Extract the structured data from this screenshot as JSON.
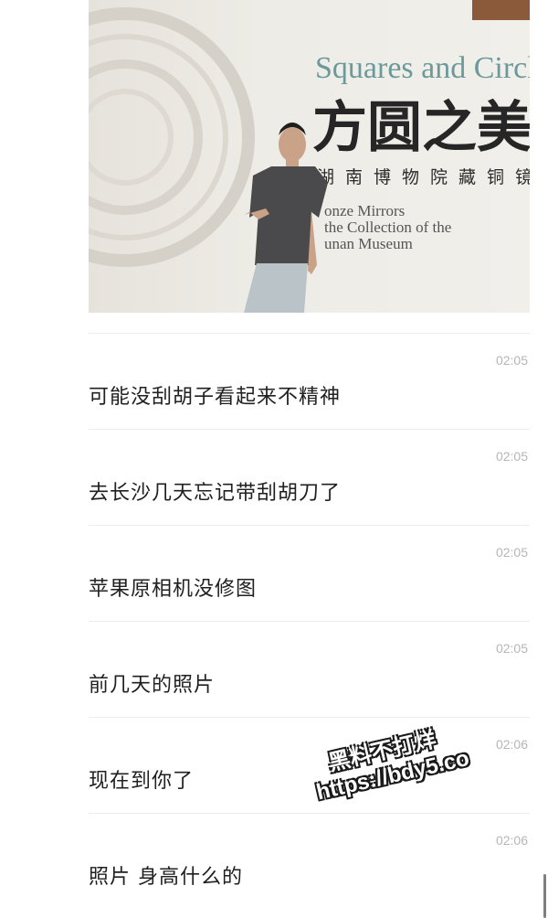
{
  "photo": {
    "sign_title_en": "Squares and Circles",
    "sign_title_zh": "方圆之美",
    "sign_subtitle_zh": "湖南博物院藏铜镜",
    "sign_subtitle_en_1": "onze Mirrors",
    "sign_subtitle_en_2": "the Collection of the",
    "sign_subtitle_en_3": "unan Museum"
  },
  "messages": [
    {
      "time": "02:05",
      "text": "可能没刮胡子看起来不精神"
    },
    {
      "time": "02:05",
      "text": "去长沙几天忘记带刮胡刀了"
    },
    {
      "time": "02:05",
      "text": "苹果原相机没修图"
    },
    {
      "time": "02:05",
      "text": "前几天的照片"
    },
    {
      "time": "02:06",
      "text": "现在到你了"
    },
    {
      "time": "02:06",
      "text": "照片 身高什么的"
    }
  ],
  "watermark": {
    "line1": "黑料不打烊",
    "line2": "https://bdy5.co"
  }
}
